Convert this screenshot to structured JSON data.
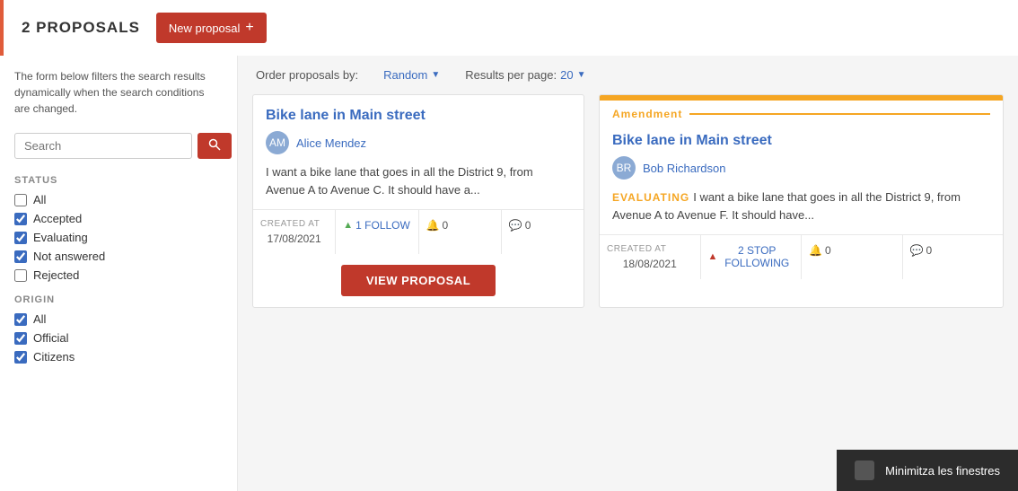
{
  "header": {
    "proposals_count": "2 PROPOSALS",
    "new_proposal_label": "New proposal",
    "plus_icon": "+"
  },
  "order_bar": {
    "order_label": "Order proposals by:",
    "order_value": "Random",
    "results_label": "Results per page:",
    "results_value": "20"
  },
  "sidebar": {
    "info_text": "The form below filters the search results dynamically when the search conditions are changed.",
    "search_placeholder": "Search",
    "status_title": "STATUS",
    "status_filters": [
      {
        "label": "All",
        "checked": false,
        "indeterminate": true
      },
      {
        "label": "Accepted",
        "checked": true
      },
      {
        "label": "Evaluating",
        "checked": true
      },
      {
        "label": "Not answered",
        "checked": true
      },
      {
        "label": "Rejected",
        "checked": false
      }
    ],
    "origin_title": "ORIGIN",
    "origin_filters": [
      {
        "label": "All",
        "checked": true
      },
      {
        "label": "Official",
        "checked": true
      },
      {
        "label": "Citizens",
        "checked": true
      }
    ]
  },
  "proposals": [
    {
      "type": "proposal",
      "title": "Bike lane in Main street",
      "author": "Alice Mendez",
      "author_avatar": "AM",
      "text": "I want a bike lane that goes in all the District 9, from Avenue A to Avenue C. It should have a...",
      "created_at_label": "CREATED AT",
      "created_at": "17/08/2021",
      "follow_label": "1 FOLLOW",
      "votes": "0",
      "comments": "0",
      "view_btn": "VIEW PROPOSAL"
    },
    {
      "type": "amendment",
      "amendment_label": "Amendment",
      "title": "Bike lane in Main street",
      "author": "Bob Richardson",
      "author_avatar": "BR",
      "evaluating_badge": "EVALUATING",
      "text": "I want a bike lane that goes in all the District 9, from Avenue A to Avenue F. It should have...",
      "created_at_label": "CREATED AT",
      "created_at": "18/08/2021",
      "follow_label": "2 STOP FOLLOWING",
      "votes": "0",
      "comments": "0"
    }
  ],
  "toast": {
    "text": "Minimitza les finestres"
  }
}
